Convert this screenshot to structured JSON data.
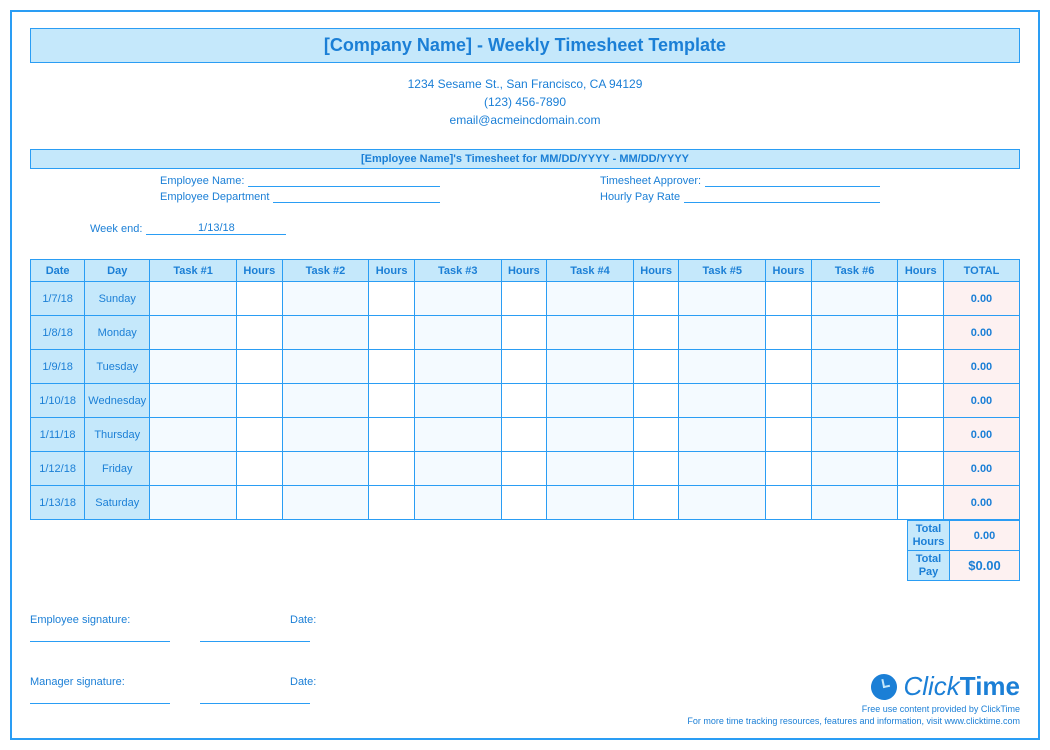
{
  "title": "[Company Name] - Weekly Timesheet Template",
  "company": {
    "address": "1234 Sesame St.,  San Francisco, CA 94129",
    "phone": "(123) 456-7890",
    "email": "email@acmeincdomain.com"
  },
  "subheader": "[Employee Name]'s Timesheet for MM/DD/YYYY - MM/DD/YYYY",
  "meta": {
    "employee_name_label": "Employee Name:",
    "employee_name": "",
    "employee_dept_label": "Employee Department",
    "employee_dept": "",
    "approver_label": "Timesheet Approver:",
    "approver": "",
    "rate_label": "Hourly Pay Rate",
    "rate": "",
    "weekend_label": "Week end:",
    "weekend": "1/13/18"
  },
  "columns": {
    "date": "Date",
    "day": "Day",
    "task1": "Task #1",
    "h1": "Hours",
    "task2": "Task #2",
    "h2": "Hours",
    "task3": "Task #3",
    "h3": "Hours",
    "task4": "Task #4",
    "h4": "Hours",
    "task5": "Task #5",
    "h5": "Hours",
    "task6": "Task #6",
    "h6": "Hours",
    "total": "TOTAL"
  },
  "rows": [
    {
      "date": "1/7/18",
      "day": "Sunday",
      "t1": "",
      "h1": "",
      "t2": "",
      "h2": "",
      "t3": "",
      "h3": "",
      "t4": "",
      "h4": "",
      "t5": "",
      "h5": "",
      "t6": "",
      "h6": "",
      "total": "0.00"
    },
    {
      "date": "1/8/18",
      "day": "Monday",
      "t1": "",
      "h1": "",
      "t2": "",
      "h2": "",
      "t3": "",
      "h3": "",
      "t4": "",
      "h4": "",
      "t5": "",
      "h5": "",
      "t6": "",
      "h6": "",
      "total": "0.00"
    },
    {
      "date": "1/9/18",
      "day": "Tuesday",
      "t1": "",
      "h1": "",
      "t2": "",
      "h2": "",
      "t3": "",
      "h3": "",
      "t4": "",
      "h4": "",
      "t5": "",
      "h5": "",
      "t6": "",
      "h6": "",
      "total": "0.00"
    },
    {
      "date": "1/10/18",
      "day": "Wednesday",
      "t1": "",
      "h1": "",
      "t2": "",
      "h2": "",
      "t3": "",
      "h3": "",
      "t4": "",
      "h4": "",
      "t5": "",
      "h5": "",
      "t6": "",
      "h6": "",
      "total": "0.00"
    },
    {
      "date": "1/11/18",
      "day": "Thursday",
      "t1": "",
      "h1": "",
      "t2": "",
      "h2": "",
      "t3": "",
      "h3": "",
      "t4": "",
      "h4": "",
      "t5": "",
      "h5": "",
      "t6": "",
      "h6": "",
      "total": "0.00"
    },
    {
      "date": "1/12/18",
      "day": "Friday",
      "t1": "",
      "h1": "",
      "t2": "",
      "h2": "",
      "t3": "",
      "h3": "",
      "t4": "",
      "h4": "",
      "t5": "",
      "h5": "",
      "t6": "",
      "h6": "",
      "total": "0.00"
    },
    {
      "date": "1/13/18",
      "day": "Saturday",
      "t1": "",
      "h1": "",
      "t2": "",
      "h2": "",
      "t3": "",
      "h3": "",
      "t4": "",
      "h4": "",
      "t5": "",
      "h5": "",
      "t6": "",
      "h6": "",
      "total": "0.00"
    }
  ],
  "summary": {
    "total_hours_label": "Total Hours",
    "total_hours": "0.00",
    "total_pay_label": "Total Pay",
    "total_pay": "$0.00"
  },
  "signatures": {
    "emp_label": "Employee signature:",
    "mgr_label": "Manager signature:",
    "date_label": "Date:"
  },
  "branding": {
    "name": "ClickTime",
    "line1": "Free use content provided by ClickTime",
    "line2": "For more time tracking resources, features and information, visit www.clicktime.com"
  }
}
